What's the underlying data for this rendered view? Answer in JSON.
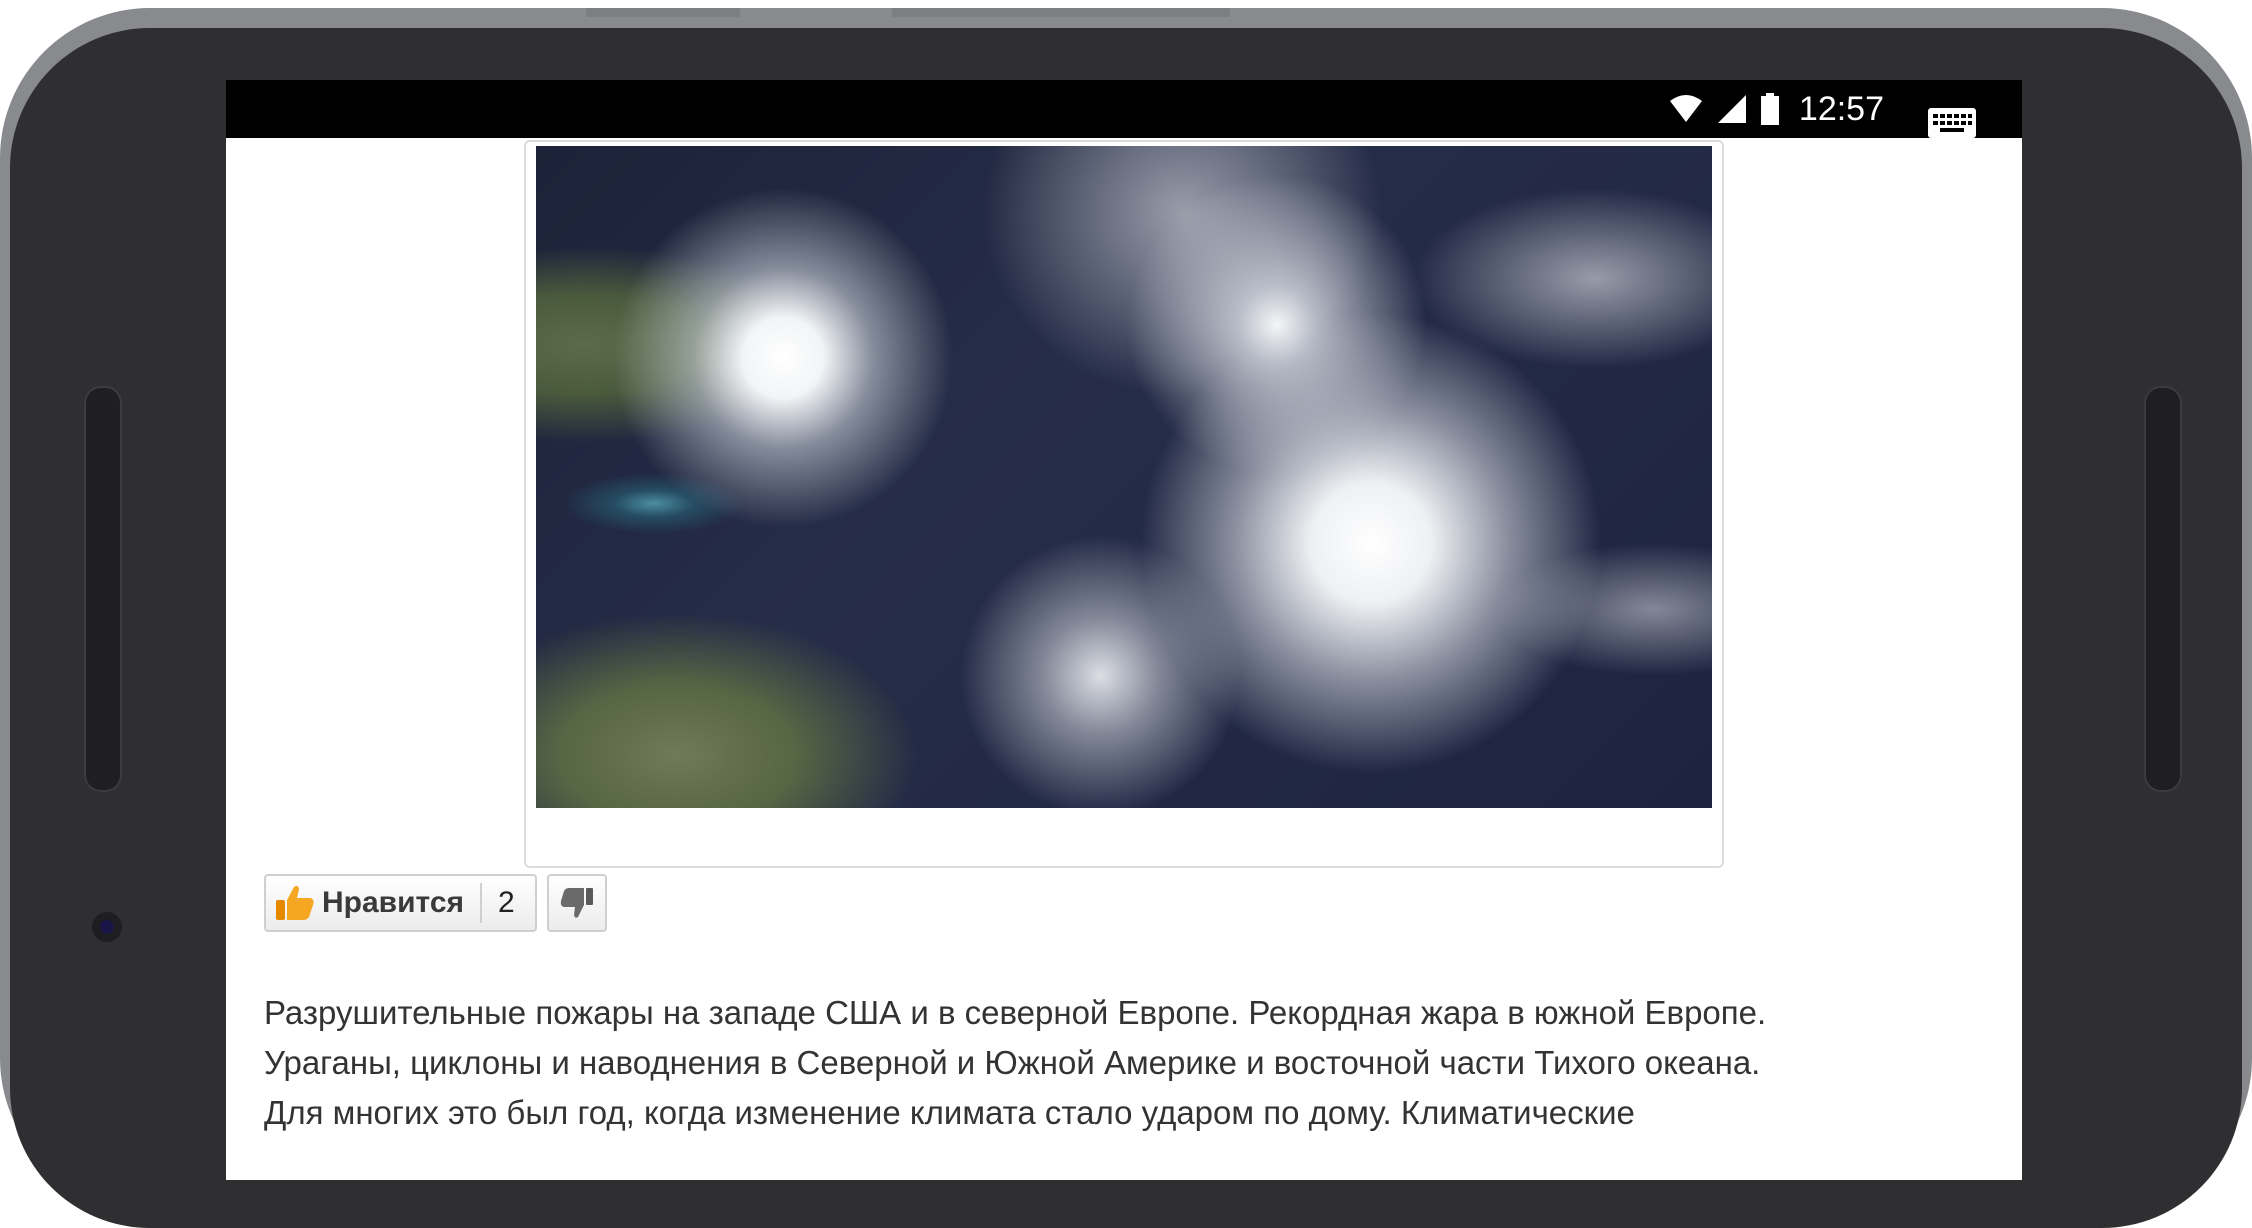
{
  "status_bar": {
    "time": "12:57",
    "icons": [
      "wifi-icon",
      "cell-signal-icon",
      "battery-icon",
      "keyboard-icon"
    ]
  },
  "article_image": {
    "description_icon": "satellite-hurricanes-image"
  },
  "reactions": {
    "like_label": "Нравится",
    "like_count": "2",
    "like_icon": "thumbs-up-icon",
    "dislike_icon": "thumbs-down-icon"
  },
  "article": {
    "lines": [
      "Разрушительные пожары на западе США и в северной Европе. Рекордная жара в южной Европе.",
      "Ураганы, циклоны и наводнения в Северной и Южной Америке и восточной части Тихого океана.",
      "Для многих это был год, когда изменение климата стало ударом по дому. Климатические"
    ]
  },
  "colors": {
    "frame": "#2f2f31",
    "frame_border": "#888a8d",
    "status_bar": "#000000",
    "like_thumb": "#f5a623"
  }
}
